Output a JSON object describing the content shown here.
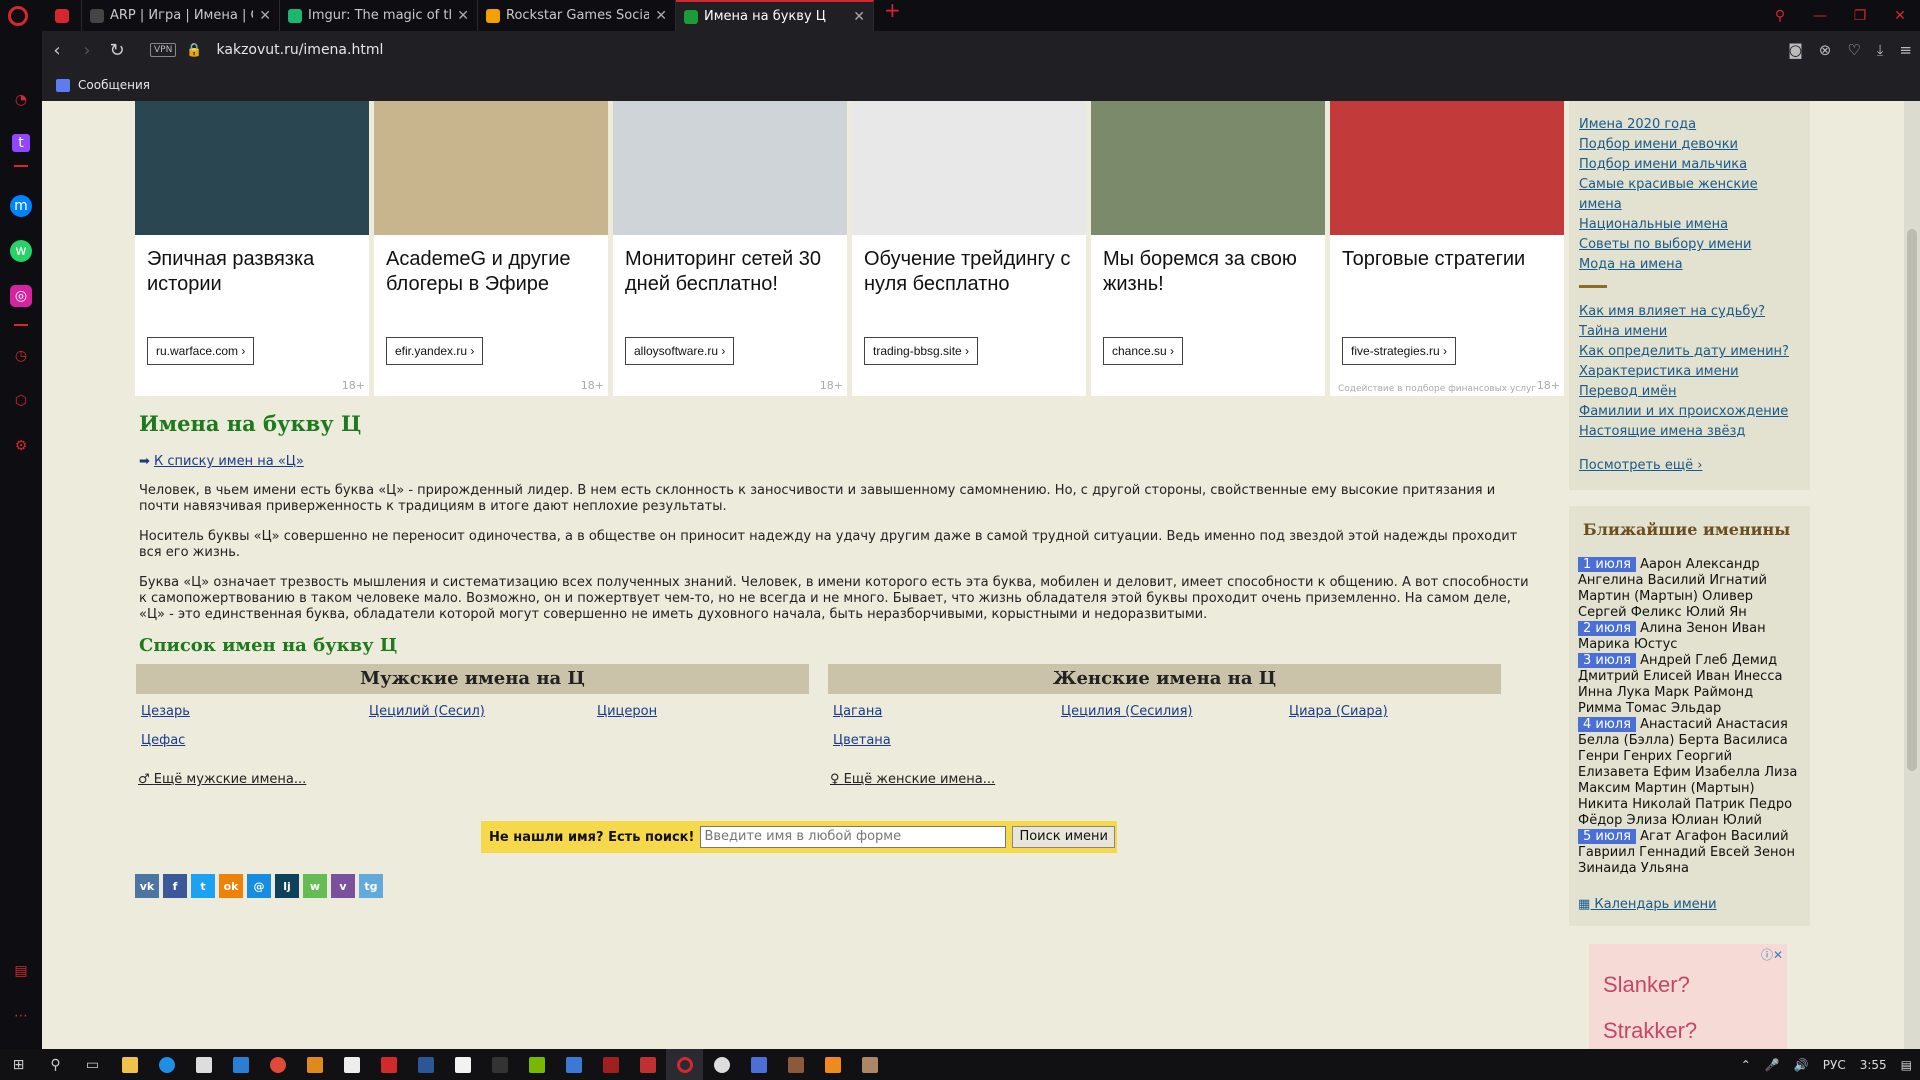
{
  "tabs": [
    {
      "title": "",
      "icon": "gamepad-icon",
      "color": "#d6262f",
      "small": true
    },
    {
      "title": "ARP | Игра | Имена | Стра",
      "icon": "opera-icon",
      "color": "#444"
    },
    {
      "title": "Imgur: The magic of the Int",
      "icon": "imgur-icon",
      "color": "#1bb76e"
    },
    {
      "title": "Rockstar Games Social Club",
      "icon": "rockstar-icon",
      "color": "#f4a100"
    },
    {
      "title": "Имена на букву Ц",
      "icon": "checkmark-icon",
      "color": "#1d9a3a",
      "active": true
    }
  ],
  "address": {
    "vpn": "VPN",
    "url": "kakzovut.ru/imena.html"
  },
  "bookmarks": {
    "messages": "Сообщения"
  },
  "ads": [
    {
      "headline": "Эпичная развязка истории",
      "domain": "ru.warface.com ›",
      "age": "18+",
      "bg": "#2a4650"
    },
    {
      "headline": "AcademeG и другие блогеры в Эфире",
      "domain": "efir.yandex.ru ›",
      "age": "18+",
      "bg": "#c9b58d"
    },
    {
      "headline": "Мониторинг сетей 30 дней бесплатно!",
      "domain": "alloysoftware.ru ›",
      "age": "18+",
      "bg": "#cfd4d8"
    },
    {
      "headline": "Обучение трейдингу с нуля бесплатно",
      "domain": "trading-bbsg.site ›",
      "age": "",
      "bg": "#e8e8e8"
    },
    {
      "headline": "Мы боремся за свою жизнь!",
      "domain": "chance.su ›",
      "age": "",
      "bg": "#7a8a6a"
    },
    {
      "headline": "Торговые стратегии",
      "domain": "five-strategies.ru ›",
      "age": "18+",
      "bg": "#c23a3a",
      "disclaimer": "Содействие в подборе финансовых услуг"
    }
  ],
  "page": {
    "title": "Имена на букву Ц",
    "back_link": "К списку имен на «Ц»",
    "paragraphs": [
      "Человек, в чьем имени есть буква «Ц» - прирожденный лидер. В нем есть склонность к заносчивости и завышенному самомнению. Но, с другой стороны, свойственные ему высокие притязания и почти навязчивая приверженность к традициям в итоге дают неплохие результаты.",
      "Носитель буквы «Ц» совершенно не переносит одиночества, а в обществе он приносит надежду на удачу другим даже в самой трудной ситуации. Ведь именно под звездой этой надежды проходит вся его жизнь.",
      "Буква «Ц» означает трезвость мышления и систематизацию всех полученных знаний. Человек, в имени которого есть эта буква, мобилен и деловит, имеет способности к общению. А вот способности к самопожертвованию в таком человеке мало. Возможно, он и пожертвует чем-то, но не всегда и не много. Бывает, что жизнь обладателя этой буквы проходит очень приземленно. На самом деле, «Ц» - это единственная буква, обладатели которой могут совершенно не иметь духовного начала, быть неразборчивыми, корыстными и недоразвитыми."
    ],
    "list_title": "Список имен на букву Ц",
    "male": {
      "heading": "Мужские имена на Ц",
      "names": [
        "Цезарь",
        "Цецилий (Сесил)",
        "Цицерон",
        "Цефас"
      ],
      "more": "Ещё мужские имена..."
    },
    "female": {
      "heading": "Женские имена на Ц",
      "names": [
        "Цагана",
        "Цецилия (Сесилия)",
        "Циара (Сиара)",
        "Цветана"
      ],
      "more": "Ещё женские имена..."
    },
    "search": {
      "label": "Не нашли имя? Есть поиск!",
      "placeholder": "Введите имя в любой форме",
      "button": "Поиск имени"
    },
    "share": [
      {
        "name": "vk",
        "label": "vk",
        "color": "#4c75a3"
      },
      {
        "name": "facebook",
        "label": "f",
        "color": "#3b5998"
      },
      {
        "name": "twitter",
        "label": "t",
        "color": "#1da1f2"
      },
      {
        "name": "odnoklassniki",
        "label": "ok",
        "color": "#ee8208"
      },
      {
        "name": "moimir",
        "label": "@",
        "color": "#168de2"
      },
      {
        "name": "livejournal",
        "label": "lj",
        "color": "#0d425a"
      },
      {
        "name": "whatsapp",
        "label": "w",
        "color": "#65bc54"
      },
      {
        "name": "viber",
        "label": "v",
        "color": "#7b519d"
      },
      {
        "name": "telegram",
        "label": "tg",
        "color": "#64a9dc"
      }
    ]
  },
  "right": {
    "links_group1": [
      "Имена 2020 года",
      "Подбор имени девочки",
      "Подбор имени мальчика",
      "Самые красивые женские имена",
      "Национальные имена",
      "Советы по выбору имени",
      "Мода на имена"
    ],
    "links_group2": [
      "Как имя влияет на судьбу?",
      "Тайна имени",
      "Как определить дату именин?",
      "Характеристика имени",
      "Перевод имён",
      "Фамилии и их происхождение",
      "Настоящие имена звёзд"
    ],
    "see_more": "Посмотреть ещё ›",
    "namedays_title": "Ближайшие именины",
    "namedays": [
      {
        "date": "1 июля",
        "names": "Аарон Александр Ангелина Василий Игнатий Мартин (Мартын) Оливер Сергей Феликс Юлий Ян"
      },
      {
        "date": "2 июля",
        "names": "Алина Зенон Иван Марика Юстус"
      },
      {
        "date": "3 июля",
        "names": "Андрей Глеб Демид Дмитрий Елисей Иван Инесса Инна Лука Марк Раймонд Римма Томас Эльдар"
      },
      {
        "date": "4 июля",
        "names": "Анастасий Анастасия Белла (Бэлла) Берта Василиса Генри Генрих Георгий Елизавета Ефим Изабелла Лиза Максим Мартин (Мартын) Никита Николай Патрик Педро Фёдор Элиза Юлиан Юлий"
      },
      {
        "date": "5 июля",
        "names": "Агат Агафон Василий Гавриил Геннадий Евсей Зенон Зинаида Ульяна"
      }
    ],
    "calendar": "Календарь имени",
    "ad_lines": [
      "Slanker?",
      "Strakker?"
    ]
  },
  "taskbar": {
    "lang": "РУС",
    "time": "3:55"
  }
}
